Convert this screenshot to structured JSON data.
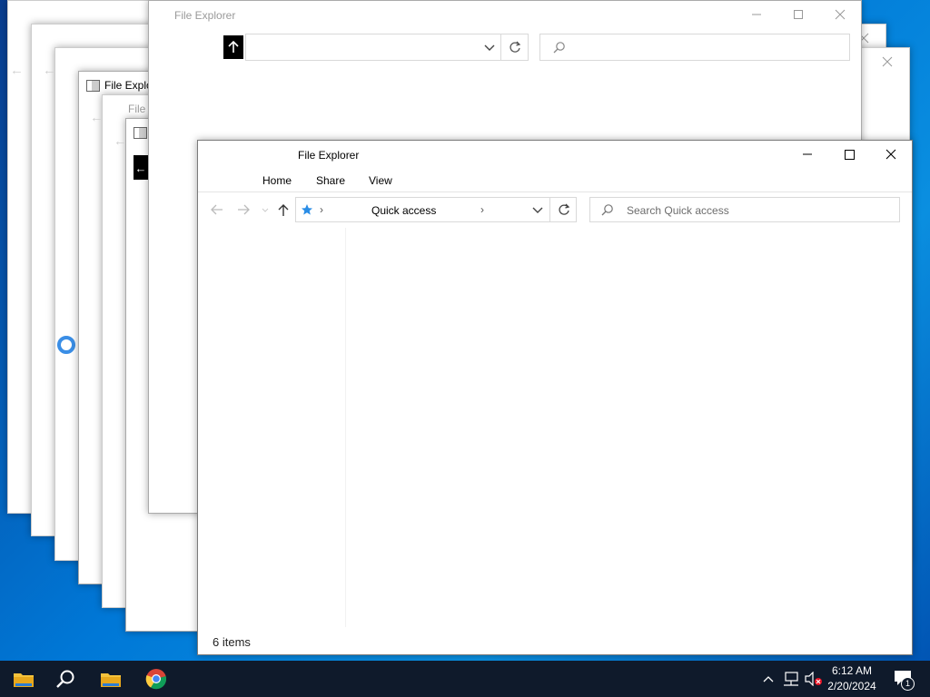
{
  "desktop": {
    "ghost_windows": [
      {
        "title": "File Explorer"
      },
      {
        "title": "File Explo"
      },
      {
        "title": "File E"
      }
    ]
  },
  "back_window": {
    "title": "File Explorer"
  },
  "main_window": {
    "title": "File Explorer",
    "ribbon_tabs": [
      "Home",
      "Share",
      "View"
    ],
    "address": {
      "location": "Quick access"
    },
    "search": {
      "placeholder": "Search Quick access"
    },
    "status": "6 items"
  },
  "taskbar": {
    "clock_time": "6:12 AM",
    "clock_date": "2/20/2024",
    "notification_count": "1"
  },
  "icons": {
    "quick_access": "star-icon",
    "up": "up-arrow-icon",
    "back": "back-arrow-icon",
    "forward": "forward-arrow-icon",
    "refresh": "refresh-icon",
    "search": "search-icon"
  },
  "colors": {
    "accent": "#0078d7",
    "taskbar": "#0f1a2b",
    "folder": "#f4c23c"
  }
}
